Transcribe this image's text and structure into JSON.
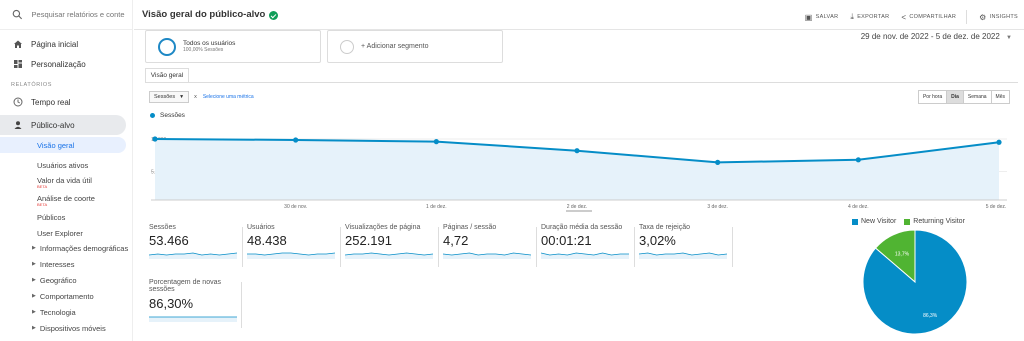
{
  "search": {
    "placeholder": "Pesquisar relatórios e conte"
  },
  "sidebar": {
    "home": "Página inicial",
    "customization": "Personalização",
    "reports_label": "RELATÓRIOS",
    "realtime": "Tempo real",
    "audience": "Público-alvo",
    "sub": {
      "overview": "Visão geral",
      "active_users": "Usuários ativos",
      "lifetime_value": "Valor da vida útil",
      "cohort": "Análise de coorte",
      "beta": "BETA",
      "audiences": "Públicos",
      "user_explorer": "User Explorer",
      "demographics": "Informações demográficas",
      "interests": "Interesses",
      "geo": "Geográfico",
      "behavior": "Comportamento",
      "technology": "Tecnologia",
      "mobile": "Dispositivos móveis"
    }
  },
  "header": {
    "title": "Visão geral do público-alvo",
    "save": "SALVAR",
    "export": "EXPORTAR",
    "share": "COMPARTILHAR",
    "insights": "INSIGHTS"
  },
  "segments": {
    "all_users": "Todos os usuários",
    "all_users_sub": "100,00% Sessões",
    "add": "+ Adicionar segmento"
  },
  "date_range": "29 de nov. de 2022 - 5 de dez. de 2022",
  "tab": "Visão geral",
  "metric_selector": {
    "value": "Sessões",
    "vs": "x",
    "pick": "Selecione uma métrica"
  },
  "granularity": [
    "Por hora",
    "Dia",
    "Semana",
    "Mês"
  ],
  "granularity_selected": "Dia",
  "chart_data": {
    "type": "line",
    "series": [
      {
        "name": "Sessões",
        "values": [
          10000,
          9850,
          9600,
          8200,
          6400,
          6800,
          9500
        ]
      }
    ],
    "x": [
      "29 de nov.",
      "30 de nov.",
      "1 de dez.",
      "2 de dez.",
      "3 de dez.",
      "4 de dez.",
      "5 de dez."
    ],
    "ytick_labels": [
      "10.000",
      "5.000"
    ],
    "yticks": [
      10000,
      5000
    ],
    "ylim": [
      0,
      12000
    ],
    "color": "#058dc7",
    "fill": "#e6f2fa"
  },
  "scorecards": [
    {
      "label": "Sessões",
      "value": "53.466"
    },
    {
      "label": "Usuários",
      "value": "48.438"
    },
    {
      "label": "Visualizações de página",
      "value": "252.191"
    },
    {
      "label": "Páginas / sessão",
      "value": "4,72"
    },
    {
      "label": "Duração média da sessão",
      "value": "00:01:21"
    },
    {
      "label": "Taxa de rejeição",
      "value": "3,02%"
    },
    {
      "label": "Porcentagem de novas sessões",
      "value": "86,30%"
    }
  ],
  "pie": {
    "type": "pie",
    "slices": [
      {
        "name": "New Visitor",
        "value": 86.3,
        "label": "86,3%",
        "color": "#058dc7"
      },
      {
        "name": "Returning Visitor",
        "value": 13.7,
        "label": "13,7%",
        "color": "#50b432"
      }
    ]
  }
}
